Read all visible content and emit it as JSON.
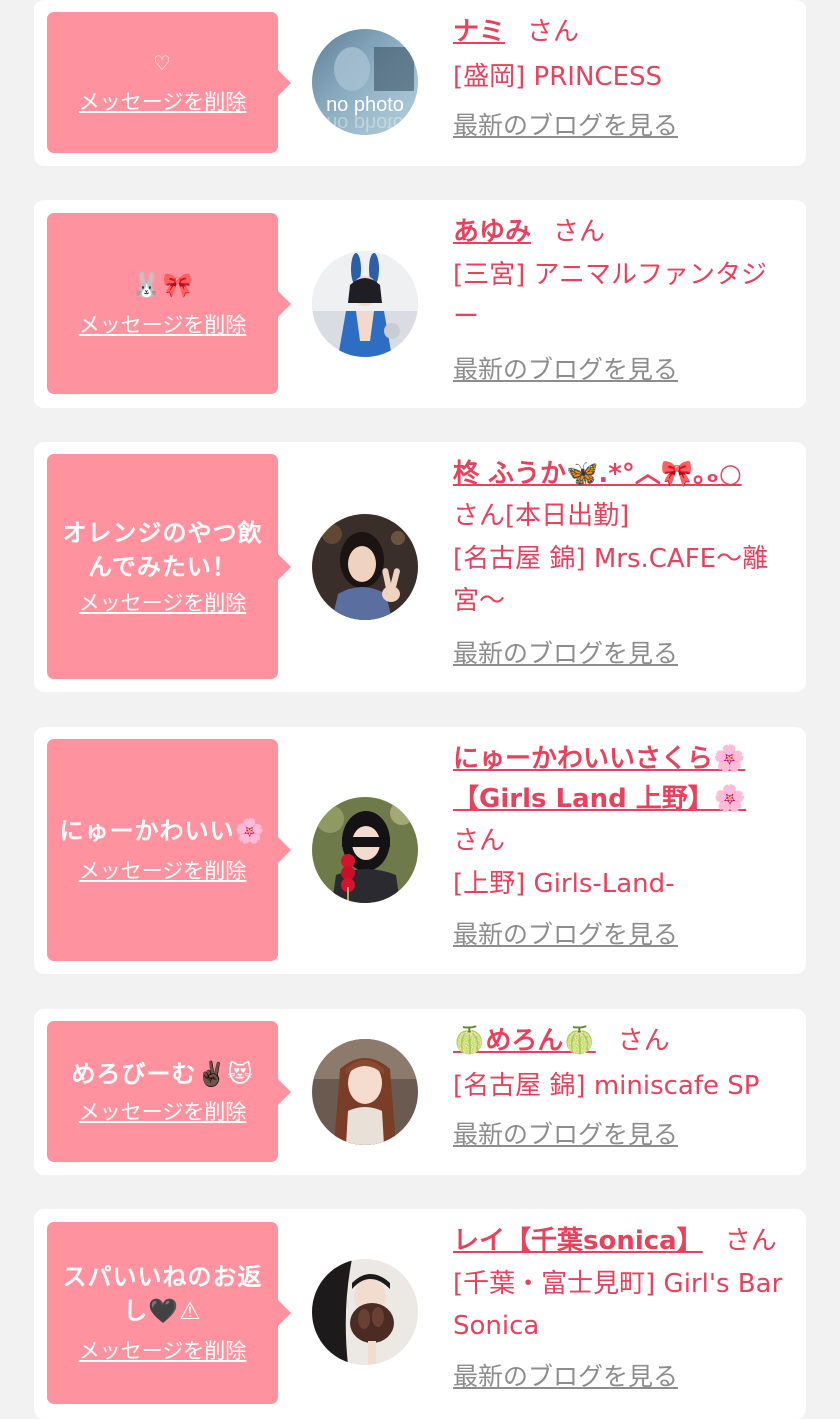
{
  "common": {
    "delete_label": "メッセージを削除",
    "blog_label": "最新のブログを見る",
    "san_label": "さん"
  },
  "colors": {
    "bubble": "#ff929e",
    "accent": "#e8415c",
    "link_gray": "#8d8d8d",
    "background": "#f2f2f2"
  },
  "messages": [
    {
      "message": "♡",
      "name": "ナミ",
      "extra": "",
      "shop": "[盛岡] PRINCESS",
      "avatar": "no-photo-avatar",
      "avatar_text": "no photo"
    },
    {
      "message": "🐰🎀",
      "name": "あゆみ",
      "extra": "",
      "shop": "[三宮] アニマルファンタジー",
      "avatar": "bunny-costume-avatar"
    },
    {
      "message": "オレンジのやつ飲んでみたい！",
      "name": "柊 ふうか🦋.*°︿🎀｡ₒ○",
      "extra": "[本日出勤]",
      "shop": "[名古屋 錦] Mrs.CAFE～離宮～",
      "avatar": "peace-sign-avatar"
    },
    {
      "message": "にゅーかわいい🌸",
      "name": "にゅーかわいいさくら🌸【Girls Land 上野】🌸",
      "extra": "",
      "shop": "[上野] Girls-Land-",
      "avatar": "candy-apple-avatar"
    },
    {
      "message": "めろびーむ✌🏿😻",
      "name": "🍈めろん🍈",
      "extra": "",
      "shop": "[名古屋 錦] miniscafe SP",
      "avatar": "long-hair-avatar"
    },
    {
      "message": "スパいいねのお返し🖤⚠",
      "name": "レイ【千葉sonica】",
      "extra": "",
      "shop": "[千葉・富士見町] Girl's Bar Sonica",
      "avatar": "glove-avatar"
    }
  ]
}
